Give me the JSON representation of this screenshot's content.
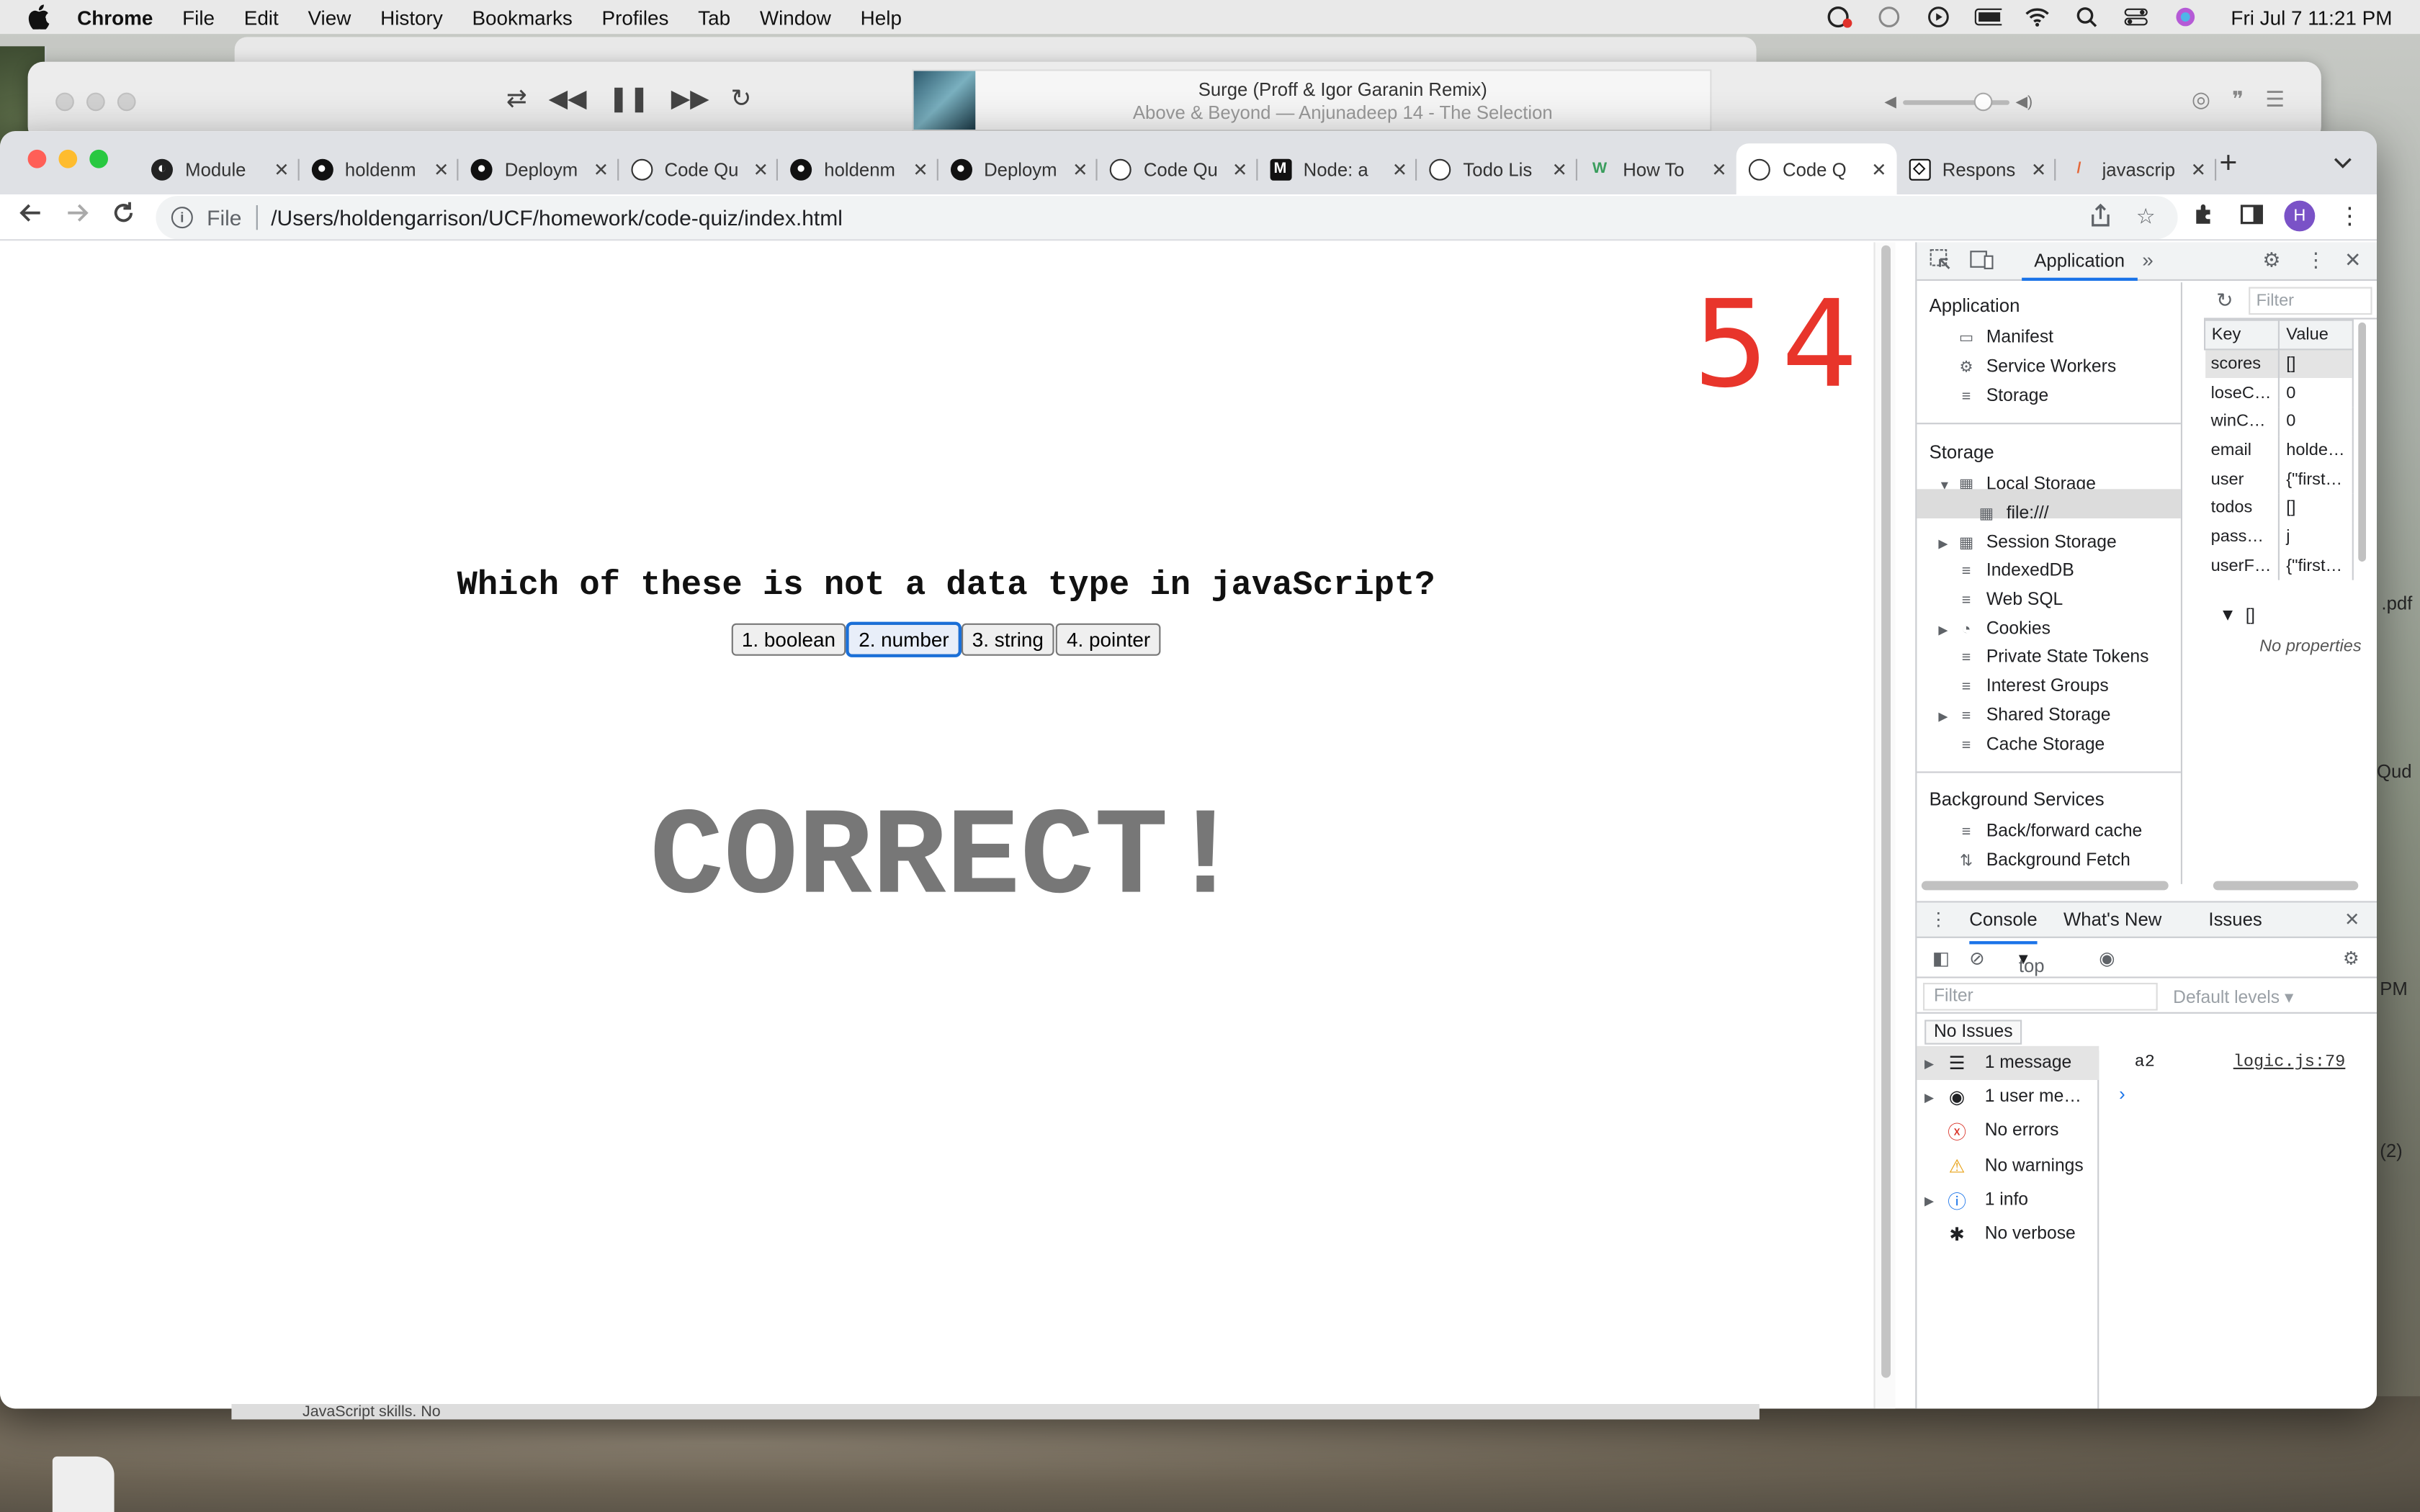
{
  "menubar": {
    "app_name": "Chrome",
    "items": [
      "File",
      "Edit",
      "View",
      "History",
      "Bookmarks",
      "Profiles",
      "Tab",
      "Window",
      "Help"
    ],
    "clock": "Fri Jul 7  11:21 PM"
  },
  "music": {
    "track_title": "Surge (Proff & Igor Garanin Remix)",
    "track_artist": "Above & Beyond — Anjunadeep 14 - The Selection",
    "volume_level": 0.75
  },
  "browser": {
    "tabs": [
      {
        "title": "Module",
        "icon": "canvas-icon"
      },
      {
        "title": "holdenm",
        "icon": "github-icon"
      },
      {
        "title": "Deploym",
        "icon": "github-icon"
      },
      {
        "title": "Code Qu",
        "icon": "globe-icon"
      },
      {
        "title": "holdenm",
        "icon": "github-icon"
      },
      {
        "title": "Deploym",
        "icon": "github-icon"
      },
      {
        "title": "Code Qu",
        "icon": "globe-icon"
      },
      {
        "title": "Node: a",
        "icon": "medium-icon"
      },
      {
        "title": "Todo Lis",
        "icon": "globe-icon"
      },
      {
        "title": "How To",
        "icon": "wikihow-icon"
      },
      {
        "title": "Code Q",
        "icon": "globe-icon"
      },
      {
        "title": "Respons",
        "icon": "codepen-icon"
      },
      {
        "title": "javascrip",
        "icon": "mdn-icon"
      }
    ],
    "active_tab_index": 10,
    "url_scheme": "File",
    "url": "/Users/holdengarrison/UCF/homework/code-quiz/index.html",
    "profile_initial": "H"
  },
  "quiz": {
    "timer": "54",
    "question": "Which of these is not a data type in javaScript?",
    "answers": [
      "1. boolean",
      "2. number",
      "3. string",
      "4. pointer"
    ],
    "result": "CORRECT!"
  },
  "devtools": {
    "panel_tab": "Application",
    "tree": {
      "application_header": "Application",
      "application_items": [
        "Manifest",
        "Service Workers",
        "Storage"
      ],
      "storage_header": "Storage",
      "local_storage": "Local Storage",
      "local_storage_child": "file:///",
      "storage_items": [
        "Session Storage",
        "IndexedDB",
        "Web SQL",
        "Cookies",
        "Private State Tokens",
        "Interest Groups",
        "Shared Storage",
        "Cache Storage"
      ],
      "background_header": "Background Services",
      "background_items": [
        "Back/forward cache",
        "Background Fetch"
      ]
    },
    "filter_placeholder": "Filter",
    "table": {
      "headers": [
        "Key",
        "Value"
      ],
      "rows": [
        [
          "scores",
          "[]"
        ],
        [
          "loseC…",
          "0"
        ],
        [
          "winC…",
          "0"
        ],
        [
          "email",
          "holde…"
        ],
        [
          "user",
          "{\"first…"
        ],
        [
          "todos",
          "[]"
        ],
        [
          "pass…",
          "j"
        ],
        [
          "userF…",
          "{\"first…"
        ]
      ]
    },
    "preview": {
      "value": "[]",
      "empty": "No properties"
    },
    "console": {
      "tabs": [
        "Console",
        "What's New",
        "Issues"
      ],
      "context": "top",
      "filter_placeholder": "Filter",
      "levels": "Default levels",
      "issues": "No Issues",
      "sidebar": [
        "1 message",
        "1 user me…",
        "No errors",
        "No warnings",
        "1 info",
        "No verbose"
      ],
      "log_text": "a2",
      "log_source": "logic.js:79"
    }
  },
  "desktop": {
    "labels": [
      ".pdf",
      "Qud",
      "PM",
      "(2)"
    ],
    "behind_window_text": "JavaScript skills. No"
  }
}
